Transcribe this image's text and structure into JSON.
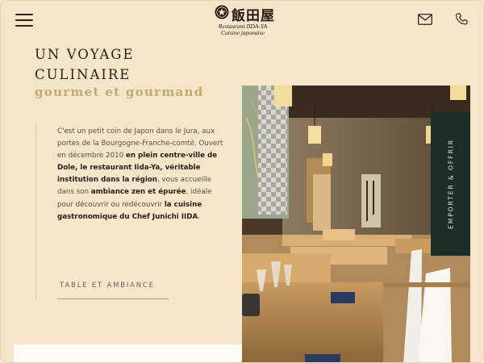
{
  "header": {
    "logo": {
      "kanji": "飯田屋",
      "line1": "Restaurant IIDA-YA",
      "line2": "Cuisine japonaise"
    },
    "icons": [
      "menu-icon",
      "mail-icon",
      "phone-icon"
    ]
  },
  "hero": {
    "title_line1": "UN VOYAGE",
    "title_line2": "CULINAIRE",
    "subtitle": "gourmet et gourmand",
    "intro": {
      "p1": "C'est un petit coin de Japon dans le Jura, aux portes de la Bourgogne-Franche-comté. Ouvert en décembre 2010 ",
      "b1": "en plein centre-ville de Dole, le restaurant Iida-Ya, véritable institution dans la région",
      "p2": ", vous accueille dans son ",
      "b2": "ambiance zen et épurée",
      "p3": ", idéale pour découvrir ou redécouvrir ",
      "b3": "la cuisine gastronomique du Chef Junichi IIDA",
      "p4": "."
    },
    "link_label": "TABLE ET AMBIANCE"
  },
  "side_tab": {
    "label": "EMPORTER & OFFRIR"
  },
  "colors": {
    "background": "#f3e6cb",
    "accent_gold": "#c7a96b",
    "text_dark": "#2b2118",
    "tab_green": "#1d2e29"
  }
}
